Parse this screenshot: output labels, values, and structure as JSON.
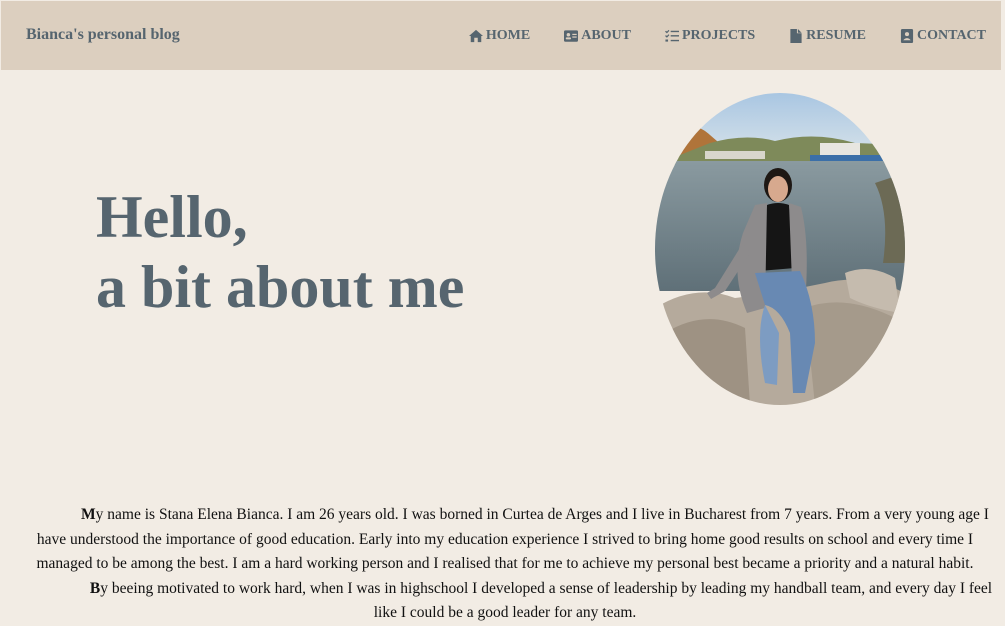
{
  "brand": "Bianca's personal blog",
  "nav": [
    {
      "label": "HOME",
      "icon": "home-icon"
    },
    {
      "label": "ABOUT",
      "icon": "id-card-icon"
    },
    {
      "label": "PROJECTS",
      "icon": "tasks-icon"
    },
    {
      "label": "RESUME",
      "icon": "file-icon"
    },
    {
      "label": "CONTACT",
      "icon": "contact-book-icon"
    }
  ],
  "hero": {
    "line1": "Hello,",
    "line2": "a bit about me"
  },
  "about": {
    "p1_cap": "M",
    "p1_rest": "y name is Stana Elena Bianca. I am 26 years old. I was borned in Curtea de Arges and I live in Bucharest from 7 years. From a very young age I have understood the importance of good education. Early into my education experience I strived to bring home good results on school and every time I managed to be among the best. I am a hard working person and I realised that for me to achieve my personal best became a priority and a natural habit.",
    "p2_cap": "B",
    "p2_rest": "y beeing motivated to work hard, when I was in highschool I developed a sense of leadership by leading my handball team, and every day I feel like I could be a good leader for any team."
  },
  "colors": {
    "background": "#f2ece4",
    "navbar": "#dccfbf",
    "accent_text": "#56656f"
  }
}
